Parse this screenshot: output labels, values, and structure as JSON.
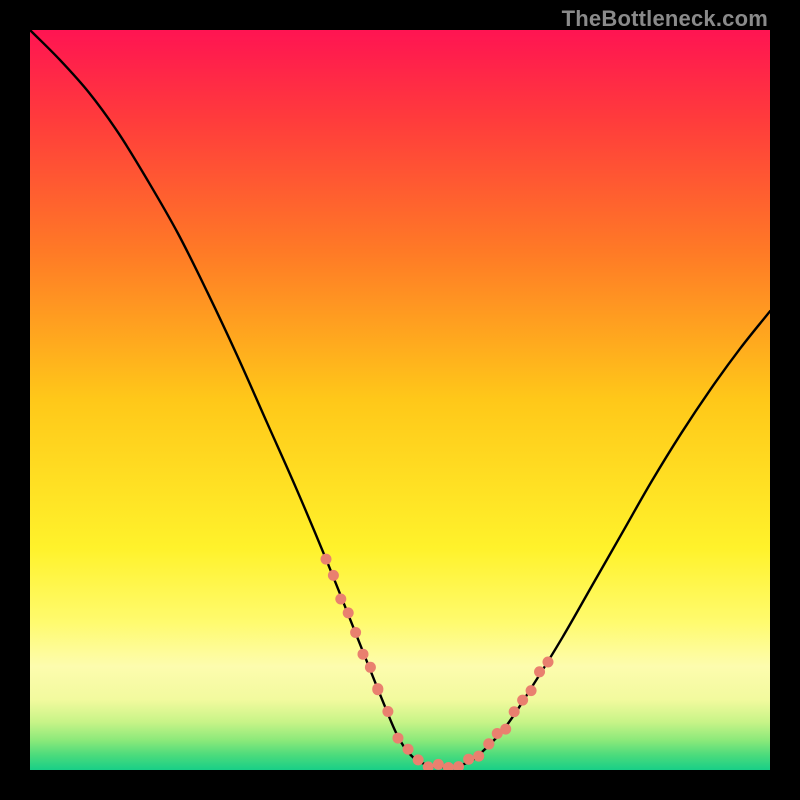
{
  "watermark": "TheBottleneck.com",
  "colors": {
    "background": "#000000",
    "curve": "#000000",
    "dots": "#e9806f",
    "gradient_stops": [
      {
        "offset": 0.0,
        "color": "#ff1452"
      },
      {
        "offset": 0.12,
        "color": "#ff3b3c"
      },
      {
        "offset": 0.3,
        "color": "#ff7a26"
      },
      {
        "offset": 0.5,
        "color": "#ffc819"
      },
      {
        "offset": 0.7,
        "color": "#fff22b"
      },
      {
        "offset": 0.8,
        "color": "#fffb6e"
      },
      {
        "offset": 0.86,
        "color": "#fdfcae"
      },
      {
        "offset": 0.905,
        "color": "#f2fa9e"
      },
      {
        "offset": 0.935,
        "color": "#c8f488"
      },
      {
        "offset": 0.96,
        "color": "#8be97a"
      },
      {
        "offset": 0.98,
        "color": "#4bdb7c"
      },
      {
        "offset": 1.0,
        "color": "#18cf87"
      }
    ]
  },
  "chart_data": {
    "type": "line",
    "title": "",
    "xlabel": "",
    "ylabel": "",
    "xlim": [
      0,
      100
    ],
    "ylim": [
      0,
      100
    ],
    "legend": false,
    "grid": false,
    "annotations": [],
    "series": [
      {
        "name": "curve",
        "x": [
          0,
          4,
          8,
          12,
          16,
          20,
          24,
          28,
          32,
          36,
          40,
          44,
          48,
          50,
          52,
          54,
          56,
          58,
          60,
          64,
          68,
          72,
          76,
          80,
          84,
          88,
          92,
          96,
          100
        ],
        "y": [
          100,
          96,
          91.5,
          86,
          79.5,
          72.5,
          64.5,
          56,
          47,
          38,
          28.5,
          18.5,
          8.5,
          4,
          1.5,
          0.6,
          0.4,
          0.6,
          1.5,
          5.5,
          11.5,
          18,
          25,
          32,
          39,
          45.5,
          51.5,
          57,
          62
        ]
      }
    ],
    "dots": {
      "name": "highlight-dots",
      "left_cluster": {
        "x_range": [
          40,
          47
        ],
        "y_range": [
          10,
          27
        ]
      },
      "bottom_cluster": {
        "x_range": [
          47,
          62
        ],
        "y_range": [
          0,
          6
        ]
      },
      "right_cluster": {
        "x_range": [
          62,
          70
        ],
        "y_range": [
          6,
          22
        ]
      }
    }
  }
}
